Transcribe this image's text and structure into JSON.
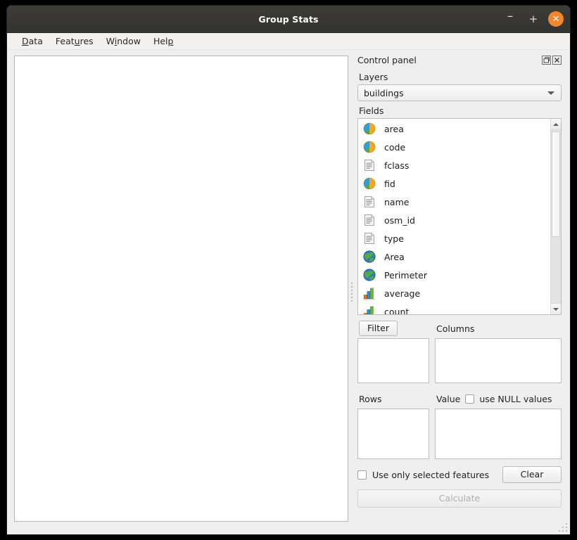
{
  "window": {
    "title": "Group Stats",
    "buttons": {
      "minimize": "–",
      "maximize": "+",
      "close": "✕"
    }
  },
  "menubar": {
    "items": [
      {
        "label": "Data",
        "mnemonic_index": 0
      },
      {
        "label": "Features",
        "mnemonic_index": 4
      },
      {
        "label": "Window",
        "mnemonic_index": 1
      },
      {
        "label": "Help",
        "mnemonic_index": 3
      }
    ]
  },
  "control_panel": {
    "title": "Control panel",
    "header_buttons": [
      {
        "name": "float-icon",
        "tooltip": "Undock"
      },
      {
        "name": "close-icon",
        "tooltip": "Close"
      }
    ],
    "layers": {
      "label": "Layers",
      "selected": "buildings",
      "options": [
        "buildings"
      ]
    },
    "fields": {
      "label": "Fields",
      "items": [
        {
          "name": "area",
          "icon": "numeric-field-icon"
        },
        {
          "name": "code",
          "icon": "numeric-field-icon"
        },
        {
          "name": "fclass",
          "icon": "text-field-icon"
        },
        {
          "name": "fid",
          "icon": "numeric-field-icon"
        },
        {
          "name": "name",
          "icon": "text-field-icon"
        },
        {
          "name": "osm_id",
          "icon": "text-field-icon"
        },
        {
          "name": "type",
          "icon": "text-field-icon"
        },
        {
          "name": "Area",
          "icon": "geometry-globe-icon"
        },
        {
          "name": "Perimeter",
          "icon": "geometry-globe-icon"
        },
        {
          "name": "average",
          "icon": "statistic-bar-icon"
        },
        {
          "name": "count",
          "icon": "statistic-bar-icon"
        }
      ],
      "scroll_position_percent": 0
    },
    "filter": {
      "button_label": "Filter",
      "value": ""
    },
    "columns": {
      "label": "Columns",
      "value": ""
    },
    "rows": {
      "label": "Rows",
      "value": ""
    },
    "value": {
      "label": "Value",
      "value": "",
      "use_null": {
        "label": "use NULL values",
        "checked": false
      }
    },
    "use_only_selected": {
      "label": "Use only selected features",
      "checked": false
    },
    "clear_button": "Clear",
    "calculate_button": "Calculate",
    "calculate_enabled": false
  },
  "colors": {
    "titlebar": "#35342f",
    "close_button": "#f0862d",
    "window_bg": "#efefef",
    "canvas_bg": "#ffffff",
    "text": "#232323"
  }
}
